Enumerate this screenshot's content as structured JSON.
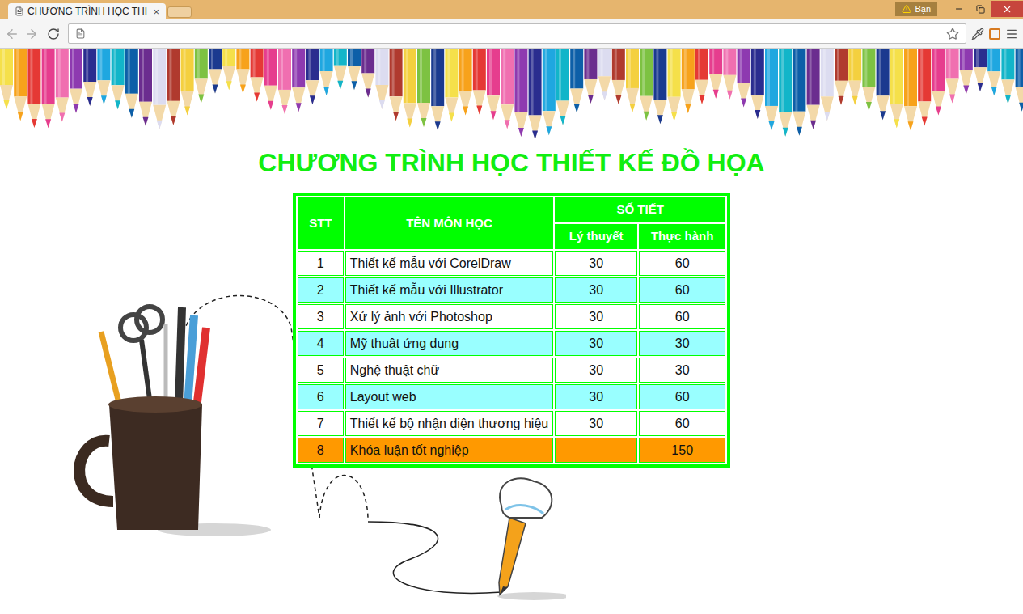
{
  "browser": {
    "tab": {
      "title": "CHƯƠNG TRÌNH HỌC THI",
      "close": "×",
      "selected": true
    },
    "profile_badge": "Bạn"
  },
  "page": {
    "title": "CHƯƠNG TRÌNH HỌC THIẾT KẾ ĐỒ HỌA"
  },
  "table": {
    "columns": {
      "stt": "STT",
      "name": "TÊN MÔN HỌC",
      "hours": "SỐ TIẾT",
      "theory": "Lý thuyết",
      "practice": "Thực hành"
    },
    "rows": [
      {
        "stt": "1",
        "name": "Thiết kế mẫu với CorelDraw",
        "theory": "30",
        "practice": "60",
        "color": "#ffffff"
      },
      {
        "stt": "2",
        "name": "Thiết kế mẫu với Illustrator",
        "theory": "30",
        "practice": "60",
        "color": "#99ffff"
      },
      {
        "stt": "3",
        "name": "Xử lý ảnh với Photoshop",
        "theory": "30",
        "practice": "60",
        "color": "#ffffff"
      },
      {
        "stt": "4",
        "name": "Mỹ thuật ứng dụng",
        "theory": "30",
        "practice": "30",
        "color": "#99ffff"
      },
      {
        "stt": "5",
        "name": "Nghệ thuật chữ",
        "theory": "30",
        "practice": "30",
        "color": "#ffffff"
      },
      {
        "stt": "6",
        "name": "Layout web",
        "theory": "30",
        "practice": "60",
        "color": "#99ffff"
      },
      {
        "stt": "7",
        "name": "Thiết kế bộ nhận diện thương hiệu",
        "theory": "30",
        "practice": "60",
        "color": "#ffffff"
      },
      {
        "stt": "8",
        "name": "Khóa luận tốt nghiệp",
        "theory": "",
        "practice": "150",
        "color": "#ff9900"
      }
    ]
  }
}
